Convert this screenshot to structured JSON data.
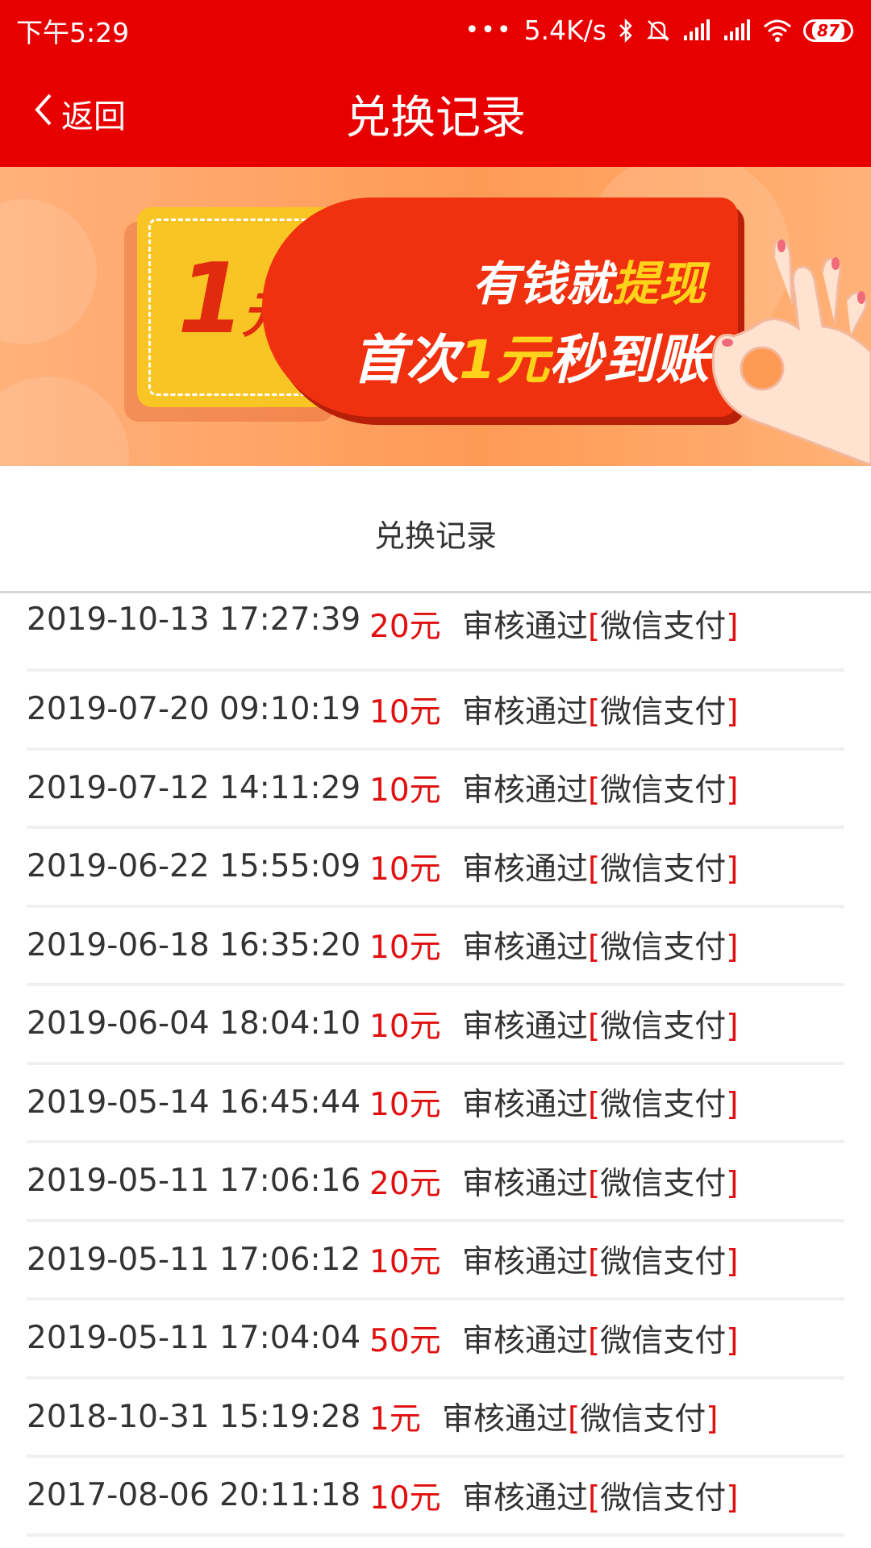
{
  "status_bar": {
    "time": "下午5:29",
    "dots": "•••",
    "network_speed": "5.4K/s",
    "battery": "87",
    "icons": [
      "bluetooth-icon",
      "mute-icon",
      "signal-icon",
      "signal-icon",
      "wifi-icon",
      "battery-icon"
    ]
  },
  "header": {
    "back_label": "返回",
    "title": "兑换记录"
  },
  "banner": {
    "coupon_amount": "1",
    "coupon_unit": "元",
    "line1_prefix": "有钱就",
    "line1_highlight": "提现",
    "line2_prefix": "首次",
    "line2_highlight": "1元",
    "line2_suffix": "秒到账"
  },
  "records_section": {
    "title": "兑换记录"
  },
  "records": [
    {
      "time": "2019-10-13 17:27:39",
      "amount": "20元",
      "status": "审核通过",
      "method": "微信支付"
    },
    {
      "time": "2019-07-20 09:10:19",
      "amount": "10元",
      "status": "审核通过",
      "method": "微信支付"
    },
    {
      "time": "2019-07-12 14:11:29",
      "amount": "10元",
      "status": "审核通过",
      "method": "微信支付"
    },
    {
      "time": "2019-06-22 15:55:09",
      "amount": "10元",
      "status": "审核通过",
      "method": "微信支付"
    },
    {
      "time": "2019-06-18 16:35:20",
      "amount": "10元",
      "status": "审核通过",
      "method": "微信支付"
    },
    {
      "time": "2019-06-04 18:04:10",
      "amount": "10元",
      "status": "审核通过",
      "method": "微信支付"
    },
    {
      "time": "2019-05-14 16:45:44",
      "amount": "10元",
      "status": "审核通过",
      "method": "微信支付"
    },
    {
      "time": "2019-05-11 17:06:16",
      "amount": "20元",
      "status": "审核通过",
      "method": "微信支付"
    },
    {
      "time": "2019-05-11 17:06:12",
      "amount": "10元",
      "status": "审核通过",
      "method": "微信支付"
    },
    {
      "time": "2019-05-11 17:04:04",
      "amount": "50元",
      "status": "审核通过",
      "method": "微信支付"
    },
    {
      "time": "2018-10-31 15:19:28",
      "amount": "1元",
      "status": "审核通过",
      "method": "微信支付"
    },
    {
      "time": "2017-08-06 20:11:18",
      "amount": "10元",
      "status": "审核通过",
      "method": "微信支付"
    }
  ],
  "colors": {
    "brand_red": "#e80000",
    "amount_red": "#e01010",
    "banner_orange": "#ff9a55",
    "coupon_yellow": "#f9c524"
  }
}
